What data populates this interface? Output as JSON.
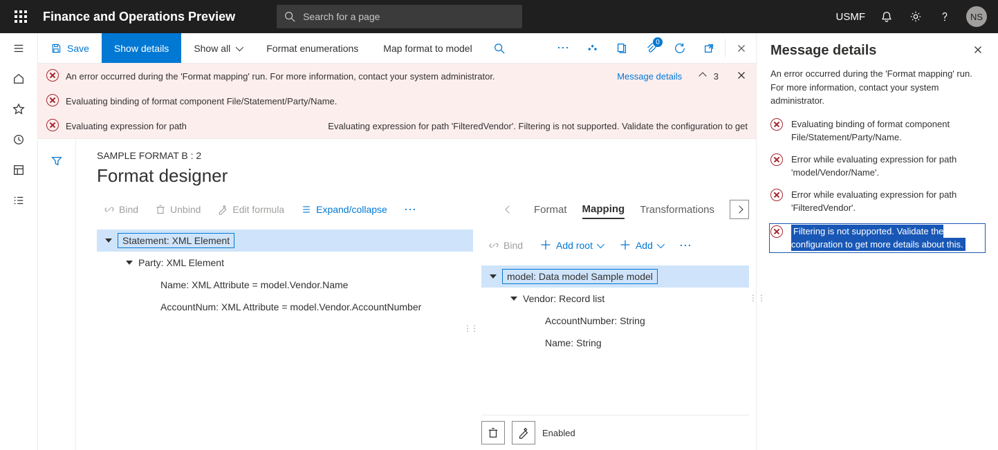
{
  "header": {
    "app_title": "Finance and Operations Preview",
    "search_placeholder": "Search for a page",
    "company": "USMF",
    "avatar_initials": "NS"
  },
  "cmdbar": {
    "save": "Save",
    "show_details": "Show details",
    "show_all": "Show all",
    "format_enums": "Format enumerations",
    "map_format": "Map format to model",
    "attach_badge": "0"
  },
  "messages": {
    "row1": "An error occurred during the 'Format mapping' run. For more information, contact your system administrator.",
    "details_link": "Message details",
    "count": "3",
    "row2": "Evaluating binding of format component File/Statement/Party/Name.",
    "row3_lead": "Evaluating expression for path",
    "row3_trail": "Evaluating expression for path 'FilteredVendor'. Filtering is not supported. Validate the configuration to get"
  },
  "designer": {
    "breadcrumb": "SAMPLE FORMAT B : 2",
    "title": "Format designer",
    "left_toolbar": {
      "bind": "Bind",
      "unbind": "Unbind",
      "edit_formula": "Edit formula",
      "expand": "Expand/collapse"
    },
    "left_tree": {
      "n1": "Statement: XML Element",
      "n2": "Party: XML Element",
      "n3": "Name: XML Attribute = model.Vendor.Name",
      "n4": "AccountNum: XML Attribute = model.Vendor.AccountNumber"
    },
    "right_toolbar": {
      "bind": "Bind",
      "add_root": "Add root",
      "add": "Add"
    },
    "tabs": {
      "format": "Format",
      "mapping": "Mapping",
      "transformations": "Transformations"
    },
    "right_tree": {
      "n1": "model: Data model Sample model",
      "n2": "Vendor: Record list",
      "n3": "AccountNumber: String",
      "n4": "Name: String"
    },
    "prop": {
      "enabled": "Enabled"
    }
  },
  "details_panel": {
    "title": "Message details",
    "intro": "An error occurred during the 'Format mapping' run. For more information, contact your system administrator.",
    "items": [
      "Evaluating binding of format component File/Statement/Party/Name.",
      "Error while evaluating expression for path 'model/Vendor/Name'.",
      "Error while evaluating expression for path 'FilteredVendor'.",
      "Filtering is not supported. Validate the configuration to get more details about this."
    ]
  }
}
